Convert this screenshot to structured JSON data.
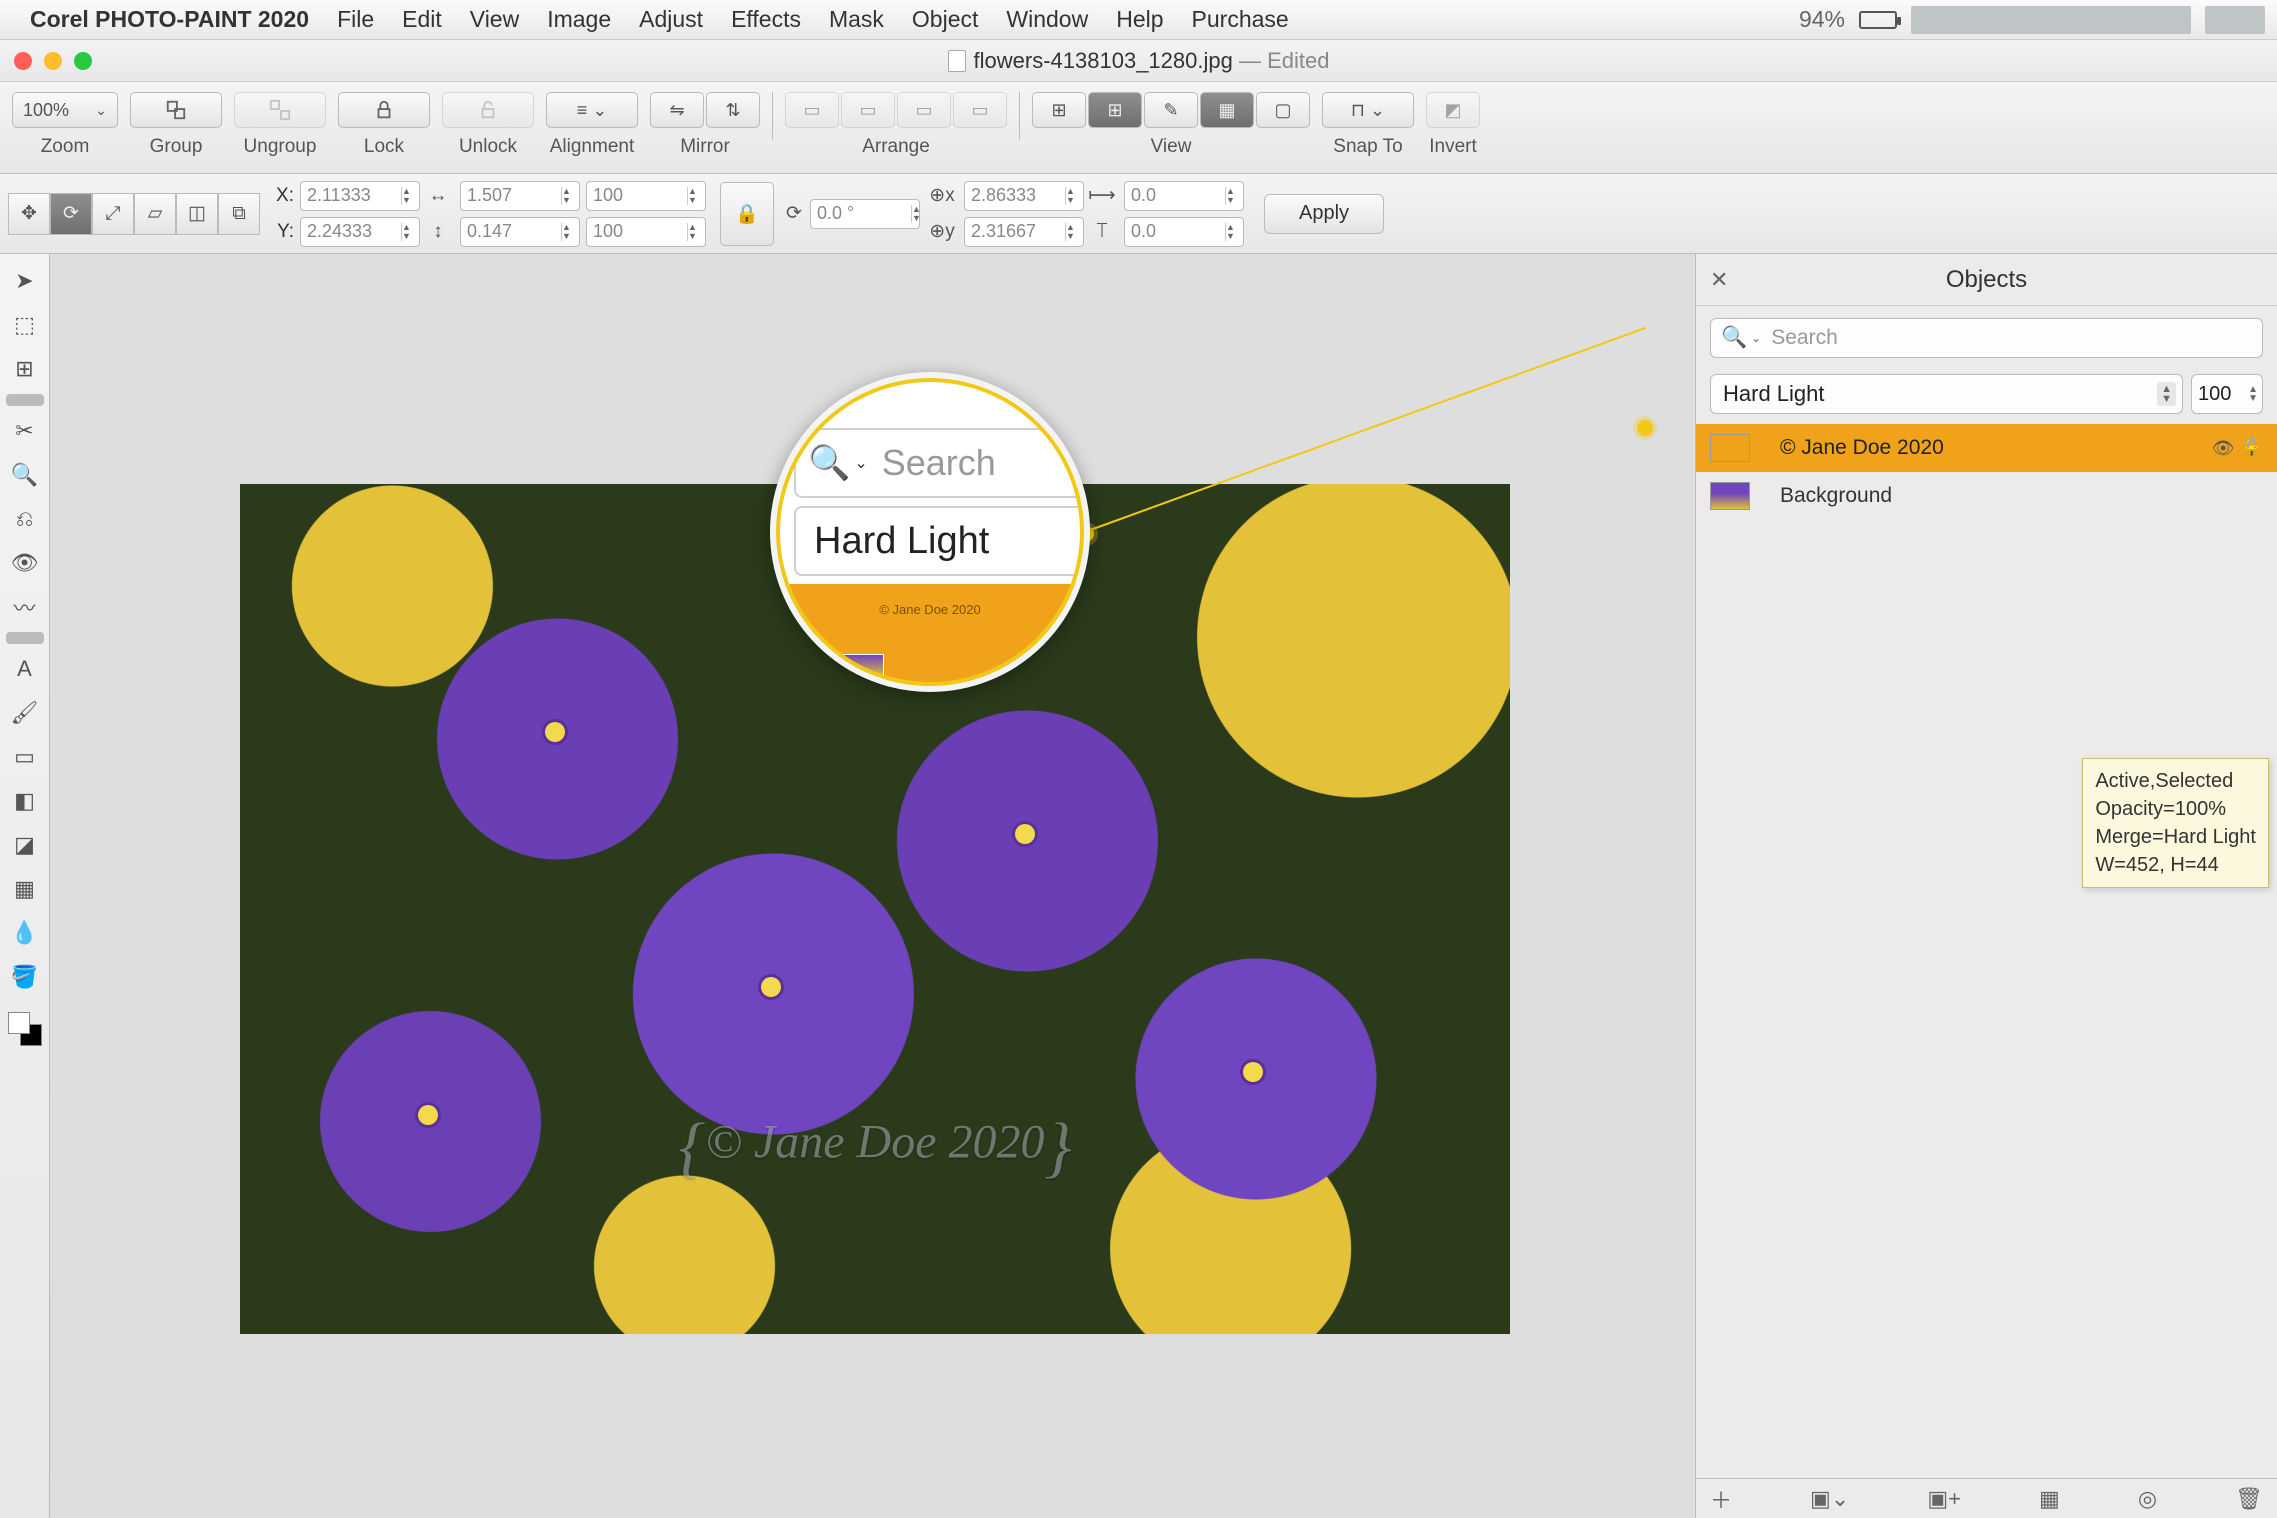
{
  "menubar": {
    "app": "Corel PHOTO-PAINT 2020",
    "items": [
      "File",
      "Edit",
      "View",
      "Image",
      "Adjust",
      "Effects",
      "Mask",
      "Object",
      "Window",
      "Help",
      "Purchase"
    ],
    "battery_pct": "94%"
  },
  "titlebar": {
    "filename": "flowers-4138103_1280.jpg",
    "edited": " — Edited"
  },
  "toolbar": {
    "zoom_value": "100%",
    "groups": {
      "zoom": "Zoom",
      "group": "Group",
      "ungroup": "Ungroup",
      "lock": "Lock",
      "unlock": "Unlock",
      "alignment": "Alignment",
      "mirror": "Mirror",
      "arrange": "Arrange",
      "view": "View",
      "snap_to": "Snap To",
      "invert": "Invert"
    }
  },
  "propbar": {
    "x": "2.11333",
    "y": "2.24333",
    "w": "1.507",
    "h": "0.147",
    "sx": "100",
    "sy": "100",
    "rot": "0.0 °",
    "cx": "2.86333",
    "cy": "2.31667",
    "skx": "0.0",
    "sky": "0.0",
    "apply": "Apply"
  },
  "objects": {
    "title": "Objects",
    "search_placeholder": "Search",
    "blend_mode": "Hard Light",
    "opacity": "100",
    "layers": [
      {
        "name": "© Jane Doe 2020",
        "selected": true
      },
      {
        "name": "Background",
        "selected": false
      }
    ],
    "tooltip": "Active,Selected\nOpacity=100%\nMerge=Hard Light\nW=452, H=44"
  },
  "callout": {
    "search_placeholder": "Search",
    "mode": "Hard Light",
    "layer_text": "© Jane Doe 2020"
  },
  "watermark": "© Jane Doe 2020"
}
